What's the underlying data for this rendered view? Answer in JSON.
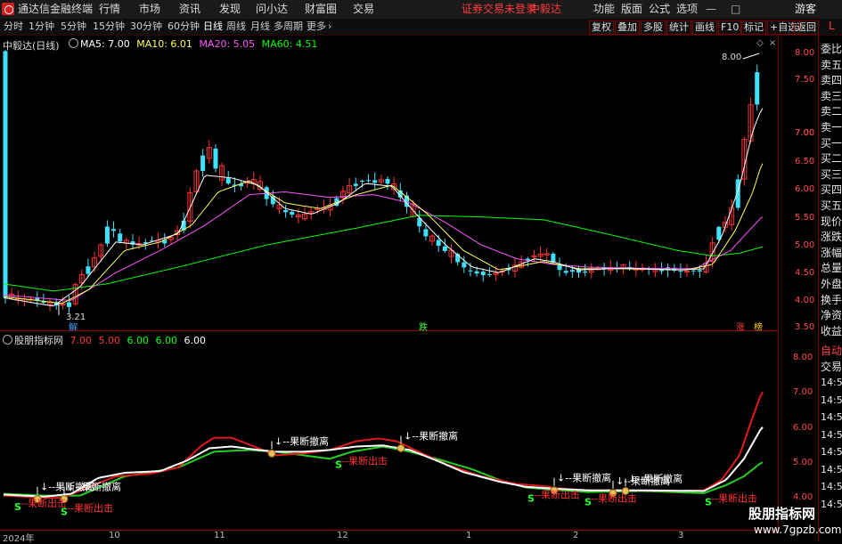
{
  "menubar": {
    "app_title": "通达信金融终端",
    "items": [
      "行情",
      "市场",
      "资讯",
      "发现",
      "问小达",
      "财富圈",
      "交易"
    ],
    "warning": "证券交易未登录",
    "stock": "中毅达",
    "right_items": [
      "功能",
      "版面",
      "公式",
      "选项"
    ],
    "guest": "游客"
  },
  "periodbar": {
    "periods": [
      "分时",
      "1分钟",
      "5分钟",
      "15分钟",
      "30分钟",
      "60分钟",
      "日线",
      "周线",
      "月线",
      "多周期",
      "更多"
    ],
    "active": "日线",
    "tools": [
      "复权",
      "叠加",
      "多股",
      "统计",
      "画线",
      "F10",
      "标记",
      "+自选",
      "返回"
    ],
    "corner": "L"
  },
  "main_chart": {
    "title": "中毅达(日线)",
    "ma": [
      {
        "label": "MA5: 7.00",
        "color": "#ffffff"
      },
      {
        "label": "MA10: 6.01",
        "color": "#ffff55"
      },
      {
        "label": "MA20: 5.05",
        "color": "#ff55ff"
      },
      {
        "label": "MA60: 4.51",
        "color": "#00ff00"
      }
    ],
    "y_ticks": [
      "8.00",
      "7.50",
      "7.00",
      "6.50",
      "6.00",
      "5.50",
      "5.00",
      "4.50",
      "4.00",
      "3.50"
    ],
    "high_label": "8.00",
    "low_label": "3.21",
    "markers": [
      "解",
      "跌",
      "涨",
      "榜"
    ]
  },
  "indicator": {
    "title": "股朋指标网",
    "values": [
      {
        "label": "7.00",
        "color": "#ff3b3b"
      },
      {
        "label": "5.00",
        "color": "#ff3b3b"
      },
      {
        "label": "6.00",
        "color": "#00ff00"
      },
      {
        "label": "6.00",
        "color": "#00ff00"
      },
      {
        "label": "6.00",
        "color": "#ffffff"
      }
    ],
    "y_ticks": [
      "8.00",
      "7.00",
      "6.00",
      "5.00",
      "4.00"
    ],
    "annotations": {
      "sell": "果断撤离",
      "buy": "果断出击",
      "s": "S"
    }
  },
  "side_panel": {
    "items": [
      "委比",
      "卖五",
      "卖四",
      "卖三",
      "卖二",
      "卖一",
      "买一",
      "买二",
      "买三",
      "买四",
      "买五",
      "现价",
      "涨跌",
      "涨幅",
      "总量",
      "外盘",
      "换手",
      "净资",
      "收益"
    ],
    "auto": "自动",
    "trade": "交易",
    "times": [
      "14:56",
      "14:56",
      "14:56",
      "14:56",
      "14:56",
      "14:56",
      "14:56",
      "14:56"
    ]
  },
  "date_axis": [
    "2024年",
    "10",
    "11",
    "12",
    "1",
    "2",
    "3"
  ],
  "watermark": {
    "line1": "股朋指标网",
    "line2": "www.7gpzb.com"
  }
}
